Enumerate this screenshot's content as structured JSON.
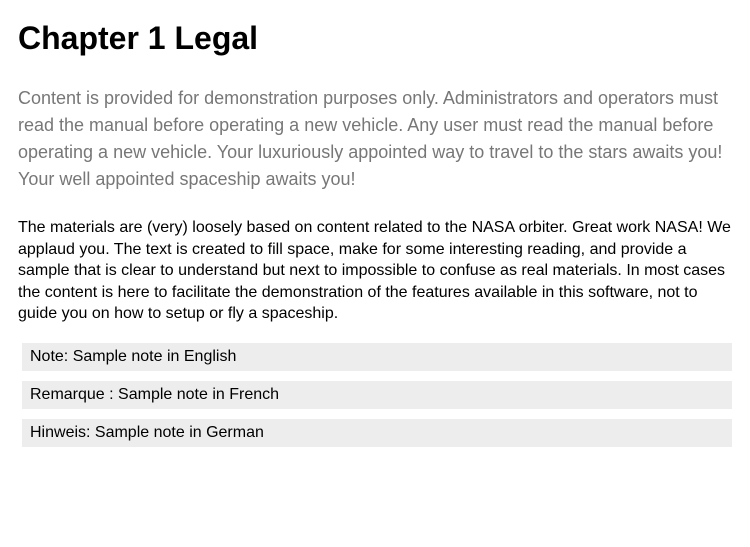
{
  "heading": "Chapter 1   Legal",
  "intro": "Content is provided for demonstration purposes only. Administrators and operators must read the manual before operating a new vehicle. Any user must read the manual before operating a new vehicle. Your luxuriously appointed way to travel to the stars awaits you! Your well appointed spaceship awaits you!",
  "body": "The materials are (very) loosely based on content related to the NASA orbiter. Great work NASA! We applaud you. The text is created to fill space, make for some interesting reading, and provide a sample that is clear to understand but next to impossible to confuse as real materials. In most cases the content is here to facilitate the demonstration of the features available in this software, not to guide you on how to setup or fly a spaceship.",
  "notes": {
    "en": "Note: Sample note in English",
    "fr": "Remarque : Sample note in French",
    "de": "Hinweis: Sample note in German"
  }
}
